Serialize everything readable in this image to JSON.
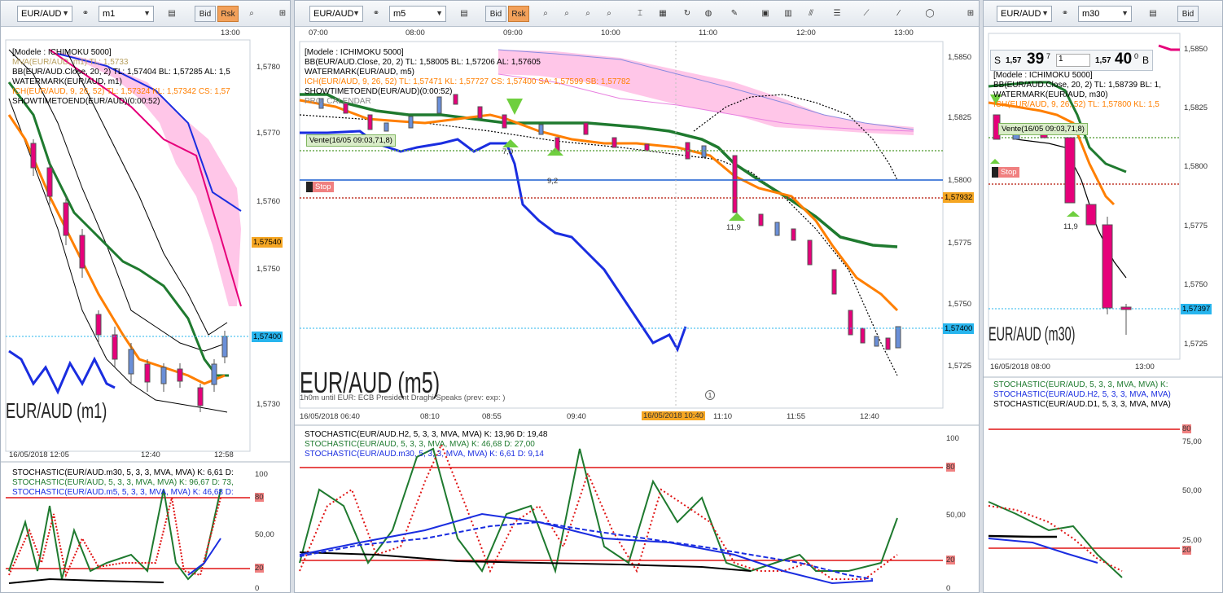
{
  "colors": {
    "accent_ask": "#f3a15a",
    "line_blue": "#1a2de0",
    "line_green": "#1f7a2f",
    "line_orange": "#ff7f00",
    "line_pink": "#e6007a",
    "cloud": "#ffc6e8",
    "stoch_red": "#e01515",
    "price_cyan": "#27b5ee",
    "tag_yellow": "#f5a623"
  },
  "left_window": {
    "symbol": "EUR/AUD",
    "timeframe": "m1",
    "bid_label": "Bid",
    "ask_label": "Rsk",
    "time_top": "13:00",
    "legend": [
      "[Modele : ICHIMOKU 5000]",
      "MVA(EUR/AUD, m1) TL: 1,5733",
      "BB(EUR/AUD.Close, 20, 2)  TL: 1,57404  BL: 1,57285  AL: 1,5",
      "WATERMARK(EUR/AUD, m1)",
      "ICH(EUR/AUD, 9, 26, 52)  TL: 1,57324  KL: 1,57342  CS: 1,57",
      "SHOWTIMETOEND(EUR/AUD)(0:00:52)"
    ],
    "y_ticks": [
      "1,5780",
      "1,5770",
      "1,5760",
      "1,5750",
      "1,5740",
      "1,5730"
    ],
    "price_tag_orange": "1,57540",
    "price_tag_cyan": "1,57400",
    "watermark": "EUR/AUD (m1)",
    "x_ticks": [
      "16/05/2018 12:05",
      "12:40",
      "12:58"
    ],
    "stoch_legend": [
      "STOCHASTIC(EUR/AUD.m30, 5, 3, 3, MVA, MVA)  K: 6,61  D:",
      "STOCHASTIC(EUR/AUD, 5, 3, 3, MVA, MVA)  K: 96,67  D: 73,",
      "STOCHASTIC(EUR/AUD.m5, 5, 3, 3, MVA, MVA)  K: 46,68  D:"
    ],
    "stoch_ticks": [
      "100",
      "80",
      "50,00",
      "20",
      "0"
    ]
  },
  "middle_window": {
    "symbol": "EUR/AUD",
    "timeframe": "m5",
    "bid_label": "Bid",
    "ask_label": "Rsk",
    "time_top": [
      "07:00",
      "08:00",
      "09:00",
      "10:00",
      "11:00",
      "12:00",
      "13:00"
    ],
    "legend": [
      "[Modele : ICHIMOKU 5000]",
      "BB(EUR/AUD.Close, 20, 2)  TL: 1,58005  BL: 1,57206  AL: 1,57605",
      "WATERMARK(EUR/AUD, m5)",
      "ICH(EUR/AUD, 9, 26, 52)  TL: 1,57471  KL: 1,57727  CS: 1,57400  SA: 1,57599  SB: 1,57782",
      "SHOWTIMETOEND(EUR/AUD)(0:00:52)",
      "PRO_CALENDAR"
    ],
    "order_sell_label": "Vente(16/05 09:03,71,8)",
    "order_stop_label": "Stop",
    "arrow_labels": [
      "7,0",
      "9,2",
      "11,9"
    ],
    "y_ticks": [
      "1,5850",
      "1,5825",
      "1,5800",
      "1,5775",
      "1,5750",
      "1,5725"
    ],
    "price_tag_orange": "1,57932",
    "price_tag_cyan": "1,57400",
    "watermark": "EUR/AUD (m5)",
    "news": "1h0m until EUR: ECB President Draghi Speaks (prev:  exp: )",
    "x_ticks": [
      "16/05/2018 06:40",
      "08:10",
      "08:55",
      "09:40",
      "16/05/2018 10:40",
      "11:10",
      "11:55",
      "12:40"
    ],
    "stoch_legend": [
      "STOCHASTIC(EUR/AUD.H2, 5, 3, 3, MVA, MVA)  K: 13,96  D: 19,48",
      "STOCHASTIC(EUR/AUD, 5, 3, 3, MVA, MVA)  K: 46,68  D: 27,00",
      "STOCHASTIC(EUR/AUD.m30, 5, 3, 3, MVA, MVA)  K: 6,61  D: 9,14"
    ],
    "stoch_ticks": [
      "100",
      "80",
      "50,00",
      "20",
      "0"
    ]
  },
  "right_window": {
    "symbol": "EUR/AUD",
    "timeframe": "m30",
    "bid_label": "Bid",
    "quote_sell_prefix": "S",
    "quote_sell_small": "1,57",
    "quote_sell_big": "39",
    "quote_sell_sup": "7",
    "quote_qty": "1",
    "quote_buy_small": "1,57",
    "quote_buy_big": "40",
    "quote_buy_sup": "0",
    "quote_buy_suffix": "B",
    "legend": [
      "[Modele : ICHIMOKU 5000]",
      "BB(EUR/AUD.Close, 20, 2)  TL: 1,58739  BL: 1,",
      "WATERMARK(EUR/AUD, m30)",
      "ICH(EUR/AUD, 9, 26, 52)  TL: 1,57800  KL: 1,5"
    ],
    "order_sell_label": "Vente(16/05 09:03,71,8)",
    "order_stop_label": "Stop",
    "arrow_label": "11,9",
    "y_ticks": [
      "1,5850",
      "1,5825",
      "1,5800",
      "1,5775",
      "1,5750",
      "1,5725"
    ],
    "price_tag_cyan": "1,57397",
    "watermark": "EUR/AUD (m30)",
    "x_ticks": [
      "16/05/2018 08:00",
      "13:00"
    ],
    "stoch_legend": [
      "STOCHASTIC(EUR/AUD, 5, 3, 3, MVA, MVA)  K:",
      "STOCHASTIC(EUR/AUD.H2, 5, 3, 3, MVA, MVA)",
      "STOCHASTIC(EUR/AUD.D1, 5, 3, 3, MVA, MVA)"
    ],
    "stoch_ticks": [
      "80",
      "75,00",
      "50,00",
      "25,00",
      "20"
    ]
  }
}
